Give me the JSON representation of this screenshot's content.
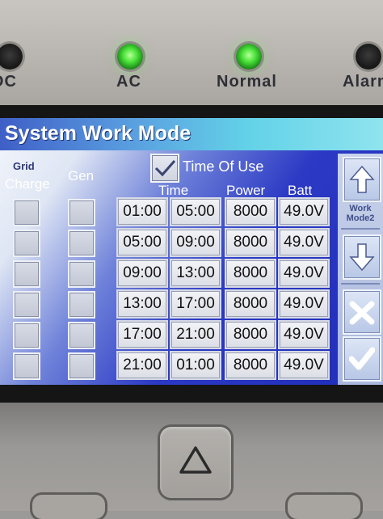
{
  "indicators": [
    {
      "label": "DC",
      "on": false
    },
    {
      "label": "AC",
      "on": true
    },
    {
      "label": "Normal",
      "on": true
    },
    {
      "label": "Alarm",
      "on": false
    }
  ],
  "screen": {
    "title": "System Work Mode",
    "headers": {
      "grid_line1": "Grid",
      "grid_line2": "Charge",
      "gen": "Gen",
      "time_of_use": "Time Of Use",
      "time": "Time",
      "power": "Power",
      "batt": "Batt"
    },
    "time_of_use_checked": true,
    "rows": [
      {
        "start": "01:00",
        "end": "05:00",
        "power": "8000",
        "batt": "49.0V"
      },
      {
        "start": "05:00",
        "end": "09:00",
        "power": "8000",
        "batt": "49.0V"
      },
      {
        "start": "09:00",
        "end": "13:00",
        "power": "8000",
        "batt": "49.0V"
      },
      {
        "start": "13:00",
        "end": "17:00",
        "power": "8000",
        "batt": "49.0V"
      },
      {
        "start": "17:00",
        "end": "21:00",
        "power": "8000",
        "batt": "49.0V"
      },
      {
        "start": "21:00",
        "end": "01:00",
        "power": "8000",
        "batt": "49.0V"
      }
    ],
    "side": {
      "mode_line1": "Work",
      "mode_line2": "Mode2"
    }
  },
  "colors": {
    "led_on": "#4be33a",
    "screen_blue": "#1f2db8",
    "title_bar": "#5aa0e0"
  },
  "icons": [
    "up-arrow-icon",
    "down-arrow-icon",
    "cancel-x-icon",
    "confirm-check-icon",
    "triangle-up-icon"
  ]
}
